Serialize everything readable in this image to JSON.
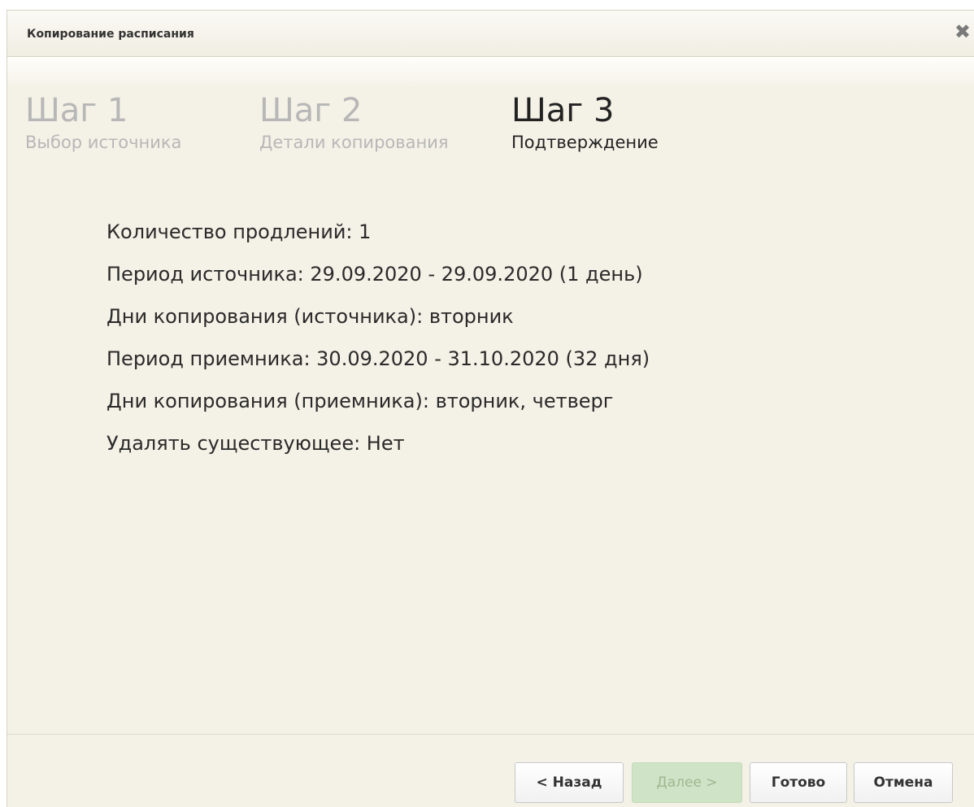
{
  "dialog": {
    "title": "Копирование расписания",
    "close_glyph": "✖"
  },
  "steps": [
    {
      "title": "Шаг 1",
      "subtitle": "Выбор источника",
      "active": false
    },
    {
      "title": "Шаг 2",
      "subtitle": "Детали копирования",
      "active": false
    },
    {
      "title": "Шаг 3",
      "subtitle": "Подтверждение",
      "active": true
    }
  ],
  "summary": [
    "Количество продлений: 1",
    "Период источника: 29.09.2020 - 29.09.2020 (1 день)",
    "Дни копирования (источника): вторник",
    "Период приемника: 30.09.2020 - 31.10.2020 (32 дня)",
    "Дни копирования (приемника): вторник, четверг",
    "Удалять существующее: Нет"
  ],
  "buttons": {
    "back": "< Назад",
    "next": "Далее >",
    "done": "Готово",
    "cancel": "Отмена"
  },
  "colors": {
    "background": "#f4f1e6",
    "inactive_step": "#b7b7b7",
    "active_step": "#222222",
    "disabled_button": "#cfe3c6"
  }
}
